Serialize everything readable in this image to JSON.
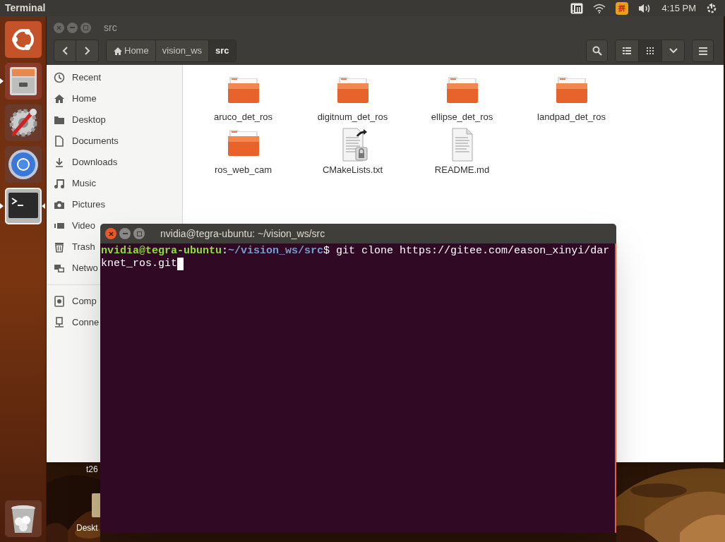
{
  "top_panel": {
    "title": "Terminal",
    "input_method": "拼",
    "clock": "4:15 PM"
  },
  "launcher": [
    {
      "kind": "ubuntu",
      "running": false,
      "focused": false
    },
    {
      "kind": "files",
      "running": true,
      "focused": false
    },
    {
      "kind": "settings",
      "running": false,
      "focused": false
    },
    {
      "kind": "browser",
      "running": false,
      "focused": false
    },
    {
      "kind": "terminal",
      "running": true,
      "focused": true
    },
    {
      "kind": "trash",
      "running": false,
      "focused": false
    }
  ],
  "desktop_icons": [
    {
      "label": "t26"
    },
    {
      "label": "Deskt",
      "kind": "package"
    }
  ],
  "file_manager": {
    "title": "src",
    "path": [
      {
        "label": "Home",
        "kind": "home",
        "selected": false
      },
      {
        "label": "vision_ws",
        "kind": "folder",
        "selected": false
      },
      {
        "label": "src",
        "kind": "folder",
        "selected": true
      }
    ],
    "views": [
      {
        "kind": "list",
        "selected": false
      },
      {
        "kind": "grid",
        "selected": true
      }
    ],
    "places": [
      {
        "kind": "recent",
        "label": "Recent"
      },
      {
        "kind": "home",
        "label": "Home"
      },
      {
        "kind": "desktop",
        "label": "Desktop"
      },
      {
        "kind": "documents",
        "label": "Documents"
      },
      {
        "kind": "downloads",
        "label": "Downloads"
      },
      {
        "kind": "music",
        "label": "Music"
      },
      {
        "kind": "pictures",
        "label": "Pictures"
      },
      {
        "kind": "videos",
        "label": "Video"
      },
      {
        "kind": "trash",
        "label": "Trash"
      },
      {
        "kind": "network",
        "label": "Netwo"
      }
    ],
    "devices": [
      {
        "kind": "computer",
        "label": "Comp"
      },
      {
        "kind": "connect",
        "label": "Conne"
      }
    ],
    "files": [
      {
        "name": "aruco_det_ros",
        "kind": "folder"
      },
      {
        "name": "digitnum_det_ros",
        "kind": "folder"
      },
      {
        "name": "ellipse_det_ros",
        "kind": "folder"
      },
      {
        "name": "landpad_det_ros",
        "kind": "folder"
      },
      {
        "name": "ros_web_cam",
        "kind": "folder"
      },
      {
        "name": "CMakeLists.txt",
        "kind": "link"
      },
      {
        "name": "README.md",
        "kind": "file"
      }
    ]
  },
  "terminal": {
    "title": "nvidia@tegra-ubuntu: ~/vision_ws/src",
    "user_host": "nvidia@tegra-ubuntu",
    "colon": ":",
    "cwd": "~/vision_ws/src",
    "command_lines": [
      "$ git clone https://gitee.com/eason_xinyi/dar",
      "knet_ros.git"
    ],
    "cursor": true
  }
}
